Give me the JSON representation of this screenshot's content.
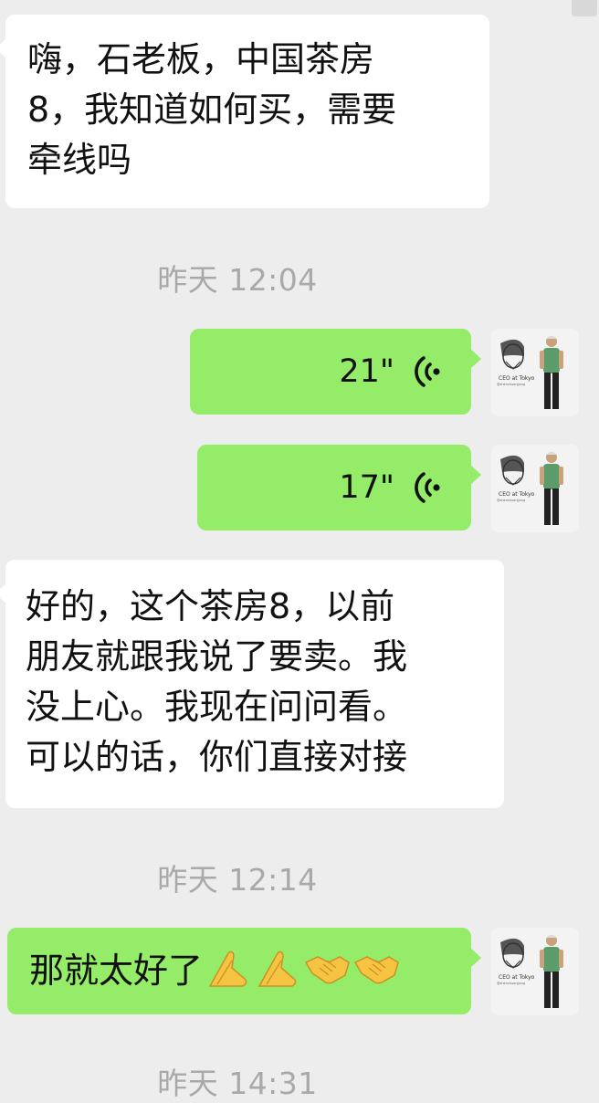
{
  "messages": [
    {
      "type": "text",
      "side": "in",
      "text": "嗨，石老板，中国茶房\n8，我知道如何买，需要\n牵线吗"
    },
    {
      "type": "time",
      "text": "昨天 12:04"
    },
    {
      "type": "voice",
      "side": "out",
      "duration": "21\""
    },
    {
      "type": "voice",
      "side": "out",
      "duration": "17\""
    },
    {
      "type": "text",
      "side": "in",
      "text": "好的，这个茶房8，以前\n朋友就跟我说了要卖。我\n没上心。我现在问问看。\n可以的话，你们直接对接"
    },
    {
      "type": "time",
      "text": "昨天 12:14"
    },
    {
      "type": "text",
      "side": "out",
      "text": "那就太好了",
      "emojis": [
        "folded-hands-emoji",
        "folded-hands-emoji",
        "handshake-emoji",
        "handshake-emoji"
      ]
    },
    {
      "type": "time",
      "text": "昨天 14:31"
    }
  ],
  "avatar": {
    "caption_line1": "CEO at Tokyo",
    "caption_line2": "@zhenshuanjjang"
  },
  "colors": {
    "background": "#ededed",
    "incoming_bubble": "#ffffff",
    "outgoing_bubble": "#95ec69",
    "timestamp": "#a9a9a9"
  },
  "icons": [
    "voice-wave-icon",
    "folded-hands-emoji",
    "handshake-emoji"
  ]
}
